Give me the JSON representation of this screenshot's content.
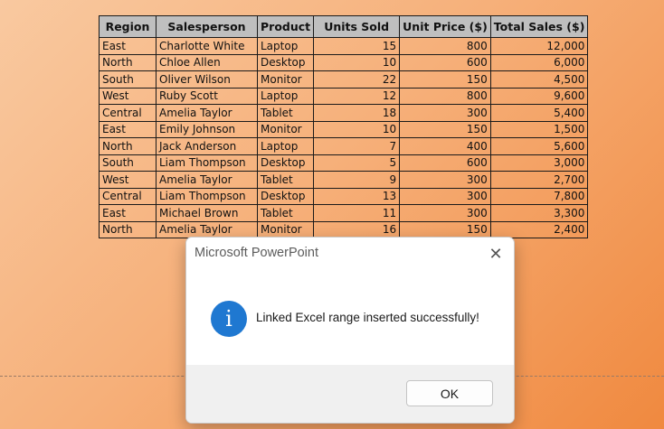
{
  "table": {
    "headers": [
      "Region",
      "Salesperson",
      "Product",
      "Units Sold",
      "Unit Price ($)",
      "Total Sales ($)"
    ],
    "rows": [
      [
        "East",
        "Charlotte White",
        "Laptop",
        "15",
        "800",
        "12,000"
      ],
      [
        "North",
        "Chloe Allen",
        "Desktop",
        "10",
        "600",
        "6,000"
      ],
      [
        "South",
        "Oliver Wilson",
        "Monitor",
        "22",
        "150",
        "4,500"
      ],
      [
        "West",
        "Ruby Scott",
        "Laptop",
        "12",
        "800",
        "9,600"
      ],
      [
        "Central",
        "Amelia Taylor",
        "Tablet",
        "18",
        "300",
        "5,400"
      ],
      [
        "East",
        "Emily Johnson",
        "Monitor",
        "10",
        "150",
        "1,500"
      ],
      [
        "North",
        "Jack Anderson",
        "Laptop",
        "7",
        "400",
        "5,600"
      ],
      [
        "South",
        "Liam Thompson",
        "Desktop",
        "5",
        "600",
        "3,000"
      ],
      [
        "West",
        "Amelia Taylor",
        "Tablet",
        "9",
        "300",
        "2,700"
      ],
      [
        "Central",
        "Liam Thompson",
        "Desktop",
        "13",
        "300",
        "7,800"
      ],
      [
        "East",
        "Michael Brown",
        "Tablet",
        "11",
        "300",
        "3,300"
      ],
      [
        "North",
        "Amelia Taylor",
        "Monitor",
        "16",
        "150",
        "2,400"
      ]
    ]
  },
  "dialog": {
    "title": "Microsoft PowerPoint",
    "close_glyph": "✕",
    "icon": "info-icon",
    "icon_glyph": "i",
    "message": "Linked Excel range inserted successfully!",
    "ok_label": "OK"
  },
  "colors": {
    "header_fill": "#bfbfbf",
    "info_icon": "#1f78d1"
  }
}
